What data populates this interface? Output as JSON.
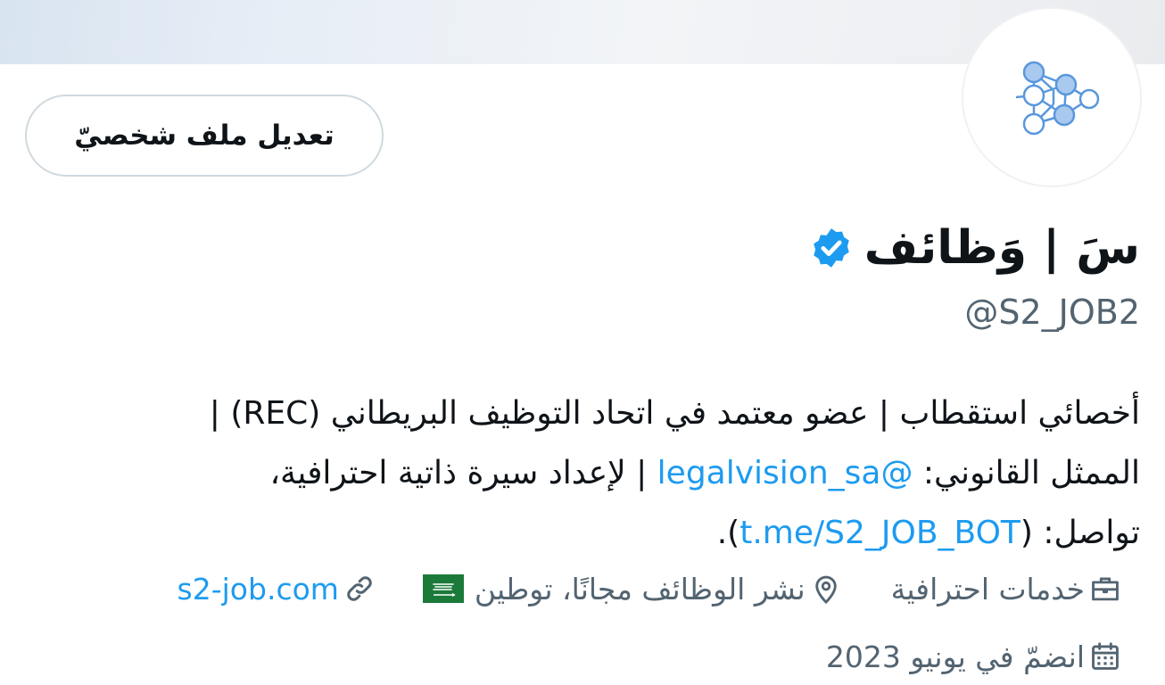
{
  "profile": {
    "edit_button_label": "تعديل ملف شخصيّ",
    "display_name": "سَ | وَظائف",
    "handle": "@S2_JOB2",
    "bio": {
      "line1": "أخصائي استقطاب | عضو معتمد في اتحاد التوظيف البريطاني (REC) |",
      "line2_prefix": "الممثل القانوني: ",
      "line2_mention": "@legalvision_sa",
      "line2_suffix": " | لإعداد سيرة ذاتية احترافية،",
      "line3_prefix": "تواصل: (",
      "line3_link": "t.me/S2_JOB_BOT",
      "line3_suffix": ")."
    },
    "category": "خدمات احترافية",
    "location": "نشر الوظائف مجانًا، توطين",
    "website": "s2-job.com",
    "joined": "انضمّ في يونيو 2023"
  },
  "colors": {
    "accent": "#1d9bf0",
    "secondary_text": "#536471",
    "verified_badge": "#1d9bf0",
    "flag_green": "#1b7a3a"
  },
  "icons": {
    "avatar_logo": "neural-network-icon",
    "verified": "verified-badge-icon",
    "category": "briefcase-icon",
    "location": "location-pin-icon",
    "flag": "saudi-flag-icon",
    "website": "link-icon",
    "joined": "calendar-icon"
  }
}
